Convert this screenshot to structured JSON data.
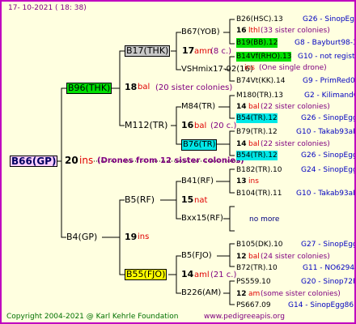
{
  "header": {
    "date": "17- 10-2021 ( 18: 38)"
  },
  "footer": {
    "copyright": "Copyright 2004-2021 @ Karl Kehrle Foundation",
    "url": "www.pedigreeapis.org"
  },
  "root": {
    "name": "B66(GP)",
    "year": "20",
    "ins": "ins",
    "drones": "(Drones from 12 sister colonies)"
  },
  "gen1": {
    "father": {
      "name": "B96(THK)",
      "year": "18",
      "mark": "bal",
      "note": "(20 sister colonies)"
    },
    "mother": {
      "name": "B4(GP)",
      "year": "19",
      "mark": "ins"
    }
  },
  "gen2": {
    "b17": {
      "name": "B17(THK)",
      "year": "17",
      "mark": "amn",
      "note": "(8 c.)"
    },
    "m112": {
      "name": "M112(TR)",
      "year": "16",
      "mark": "bal",
      "note": "(20 c.)"
    },
    "b5": {
      "name": "B5(RF)",
      "year": "15",
      "mark": "nat"
    },
    "b55": {
      "name": "B55(FJO)",
      "year": "14",
      "mark": "aml",
      "note": "(21 c.)"
    }
  },
  "gen3": {
    "b67": {
      "name": "B67(YOB)"
    },
    "vsh": {
      "name": "VSHmix17-02(16)"
    },
    "m84": {
      "name": "M84(TR)"
    },
    "b76": {
      "name": "B76(TR)"
    },
    "b41": {
      "name": "B41(RF)"
    },
    "bxx": {
      "name": "Bxx15(RF)"
    },
    "b5f": {
      "name": "B5(FJO)"
    },
    "b226": {
      "name": "B226(AM)"
    }
  },
  "gen4": [
    {
      "name": "B26(HSC).13",
      "ref": "G26 - SinopEgg"
    },
    {
      "year": "16",
      "mark": "lthl",
      "note": "(33 sister colonies)"
    },
    {
      "name": "B19(BB).12",
      "ref": "G8 - Bayburt98-3"
    },
    {
      "name": "B14Vf(RHO).13",
      "ref": "G10 - not registe"
    },
    {
      "year": "",
      "mark": "ins",
      "note": "(One single drone)"
    },
    {
      "name": "B74Vt(KK).14",
      "ref": "G9 - PrimRed01"
    },
    {
      "name": "M180(TR).13",
      "ref": "G2 - KilimandQ"
    },
    {
      "year": "14",
      "mark": "bal",
      "note": "(22 sister colonies)"
    },
    {
      "name": "B54(TR).12",
      "ref": "G26 - SinopEgg"
    },
    {
      "name": "B79(TR).12",
      "ref": "G10 - Takab93aR"
    },
    {
      "year": "14",
      "mark": "bal",
      "note": "(22 sister colonies)"
    },
    {
      "name": "B54(TR).12",
      "ref": "G26 - SinopEgg"
    },
    {
      "name": "B182(TR).10",
      "ref": "G24 - SinopEgg"
    },
    {
      "year": "13",
      "mark": "ins",
      "note": ""
    },
    {
      "name": "B104(TR).11",
      "ref": "G10 - Takab93aR"
    },
    {
      "name": "",
      "ref": "no more"
    },
    {
      "name": "B105(DK).10",
      "ref": "G27 - SinopEgg"
    },
    {
      "year": "12",
      "mark": "bal",
      "note": "(24 sister colonies)"
    },
    {
      "name": "B72(TR).10",
      "ref": "G11 - NO6294R"
    },
    {
      "name": "PS559.10",
      "ref": "G20 - Sinop72R"
    },
    {
      "year": "12",
      "mark": "am",
      "note": "(some sister colonies)"
    },
    {
      "name": "PS667.09",
      "ref": "G14 - SinopEgg86R"
    }
  ]
}
